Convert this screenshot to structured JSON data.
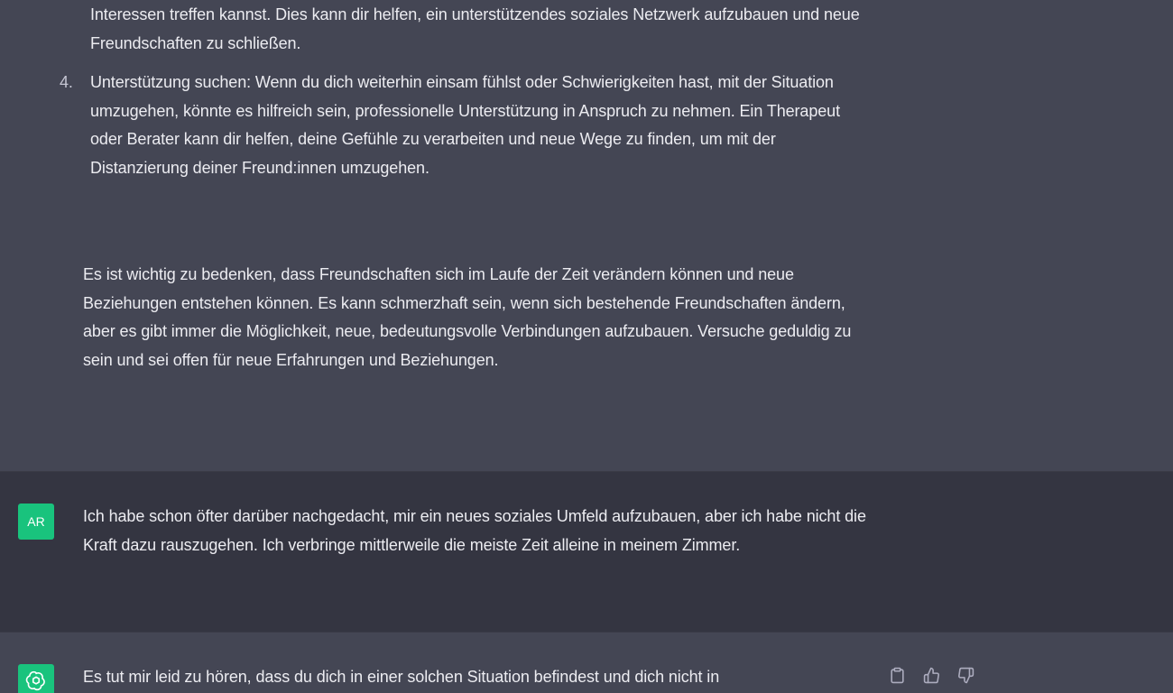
{
  "conversation": {
    "previous_message": {
      "continued_paragraph": "Interessen treffen kannst. Dies kann dir helfen, ein unterstützendes soziales Netzwerk aufzubauen und neue Freundschaften zu schließen.",
      "list_items": [
        {
          "number": "4.",
          "text": "Unterstützung suchen: Wenn du dich weiterhin einsam fühlst oder Schwierigkeiten hast, mit der Situation umzugehen, könnte es hilfreich sein, professionelle Unterstützung in Anspruch zu nehmen. Ein Therapeut oder Berater kann dir helfen, deine Gefühle zu verarbeiten und neue Wege zu finden, um mit der Distanzierung deiner Freund:innen umzugehen."
        }
      ],
      "closing_paragraph": "Es ist wichtig zu bedenken, dass Freundschaften sich im Laufe der Zeit verändern können und neue Beziehungen entstehen können. Es kann schmerzhaft sein, wenn sich bestehende Freundschaften ändern, aber es gibt immer die Möglichkeit, neue, bedeutungsvolle Verbindungen aufzubauen. Versuche geduldig zu sein und sei offen für neue Erfahrungen und Beziehungen."
    },
    "user_message": {
      "avatar_initials": "AR",
      "text": "Ich habe schon öfter darüber nachgedacht, mir ein neues soziales Umfeld aufzubauen, aber ich habe nicht die Kraft dazu rauszugehen. Ich verbringe mittlerweile die meiste Zeit alleine in meinem Zimmer."
    },
    "assistant_message": {
      "avatar_icon": "openai-logo-icon",
      "text": "Es tut mir leid zu hören, dass du dich in einer solchen Situation befindest und dich nicht in"
    },
    "actions": {
      "copy_icon": "clipboard-icon",
      "like_icon": "thumbs-up-icon",
      "dislike_icon": "thumbs-down-icon"
    }
  },
  "colors": {
    "assistant_bg": "#444654",
    "user_bg": "#343541",
    "text": "#ececf1",
    "avatar_bg": "#19c37d"
  }
}
